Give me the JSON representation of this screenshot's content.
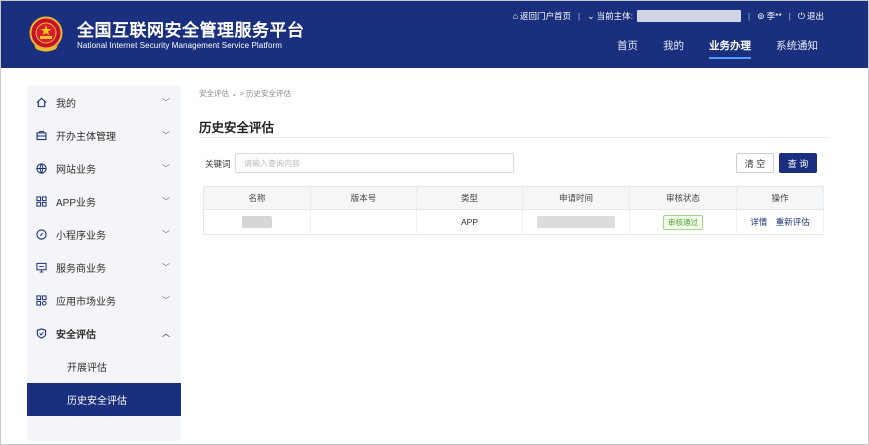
{
  "brand": {
    "title_cn": "全国互联网安全管理服务平台",
    "title_en": "National Internet Security Management Service Platform",
    "emblem_icon": "national-emblem-icon"
  },
  "topbar": {
    "home_link": "返回门户首页",
    "current_entity_label": "当前主体:",
    "user_name": "李**",
    "logout": "退出"
  },
  "nav": {
    "items": [
      {
        "label": "首页",
        "active": false
      },
      {
        "label": "我的",
        "active": false
      },
      {
        "label": "业务办理",
        "active": true
      },
      {
        "label": "系统通知",
        "active": false
      }
    ]
  },
  "sidebar": {
    "items": [
      {
        "label": "我的",
        "icon": "home-icon"
      },
      {
        "label": "开办主体管理",
        "icon": "briefcase-icon"
      },
      {
        "label": "网站业务",
        "icon": "globe-icon"
      },
      {
        "label": "APP业务",
        "icon": "grid-icon"
      },
      {
        "label": "小程序业务",
        "icon": "compass-icon"
      },
      {
        "label": "服务商业务",
        "icon": "monitor-icon"
      },
      {
        "label": "应用市场业务",
        "icon": "apps-icon"
      },
      {
        "label": "安全评估",
        "icon": "shield-icon"
      }
    ],
    "sub_items": [
      {
        "label": "开展评估",
        "active": false
      },
      {
        "label": "历史安全评估",
        "active": true
      }
    ]
  },
  "breadcrumb": {
    "parent": "安全评估",
    "separator": ">",
    "current": "历史安全评估"
  },
  "page_title": "历史安全评估",
  "search": {
    "label": "关键词",
    "placeholder": "请输入查询内容",
    "value": "",
    "clear_label": "清 空",
    "query_label": "查 询"
  },
  "table": {
    "headers": [
      "名称",
      "版本号",
      "类型",
      "申请时间",
      "审核状态",
      "操作"
    ],
    "rows": [
      {
        "name": "",
        "version": "",
        "type": "APP",
        "apply_time": "",
        "status": "审核通过",
        "actions": [
          "详情",
          "重新评估"
        ]
      }
    ]
  },
  "colors": {
    "brand_blue": "#1a2f7e",
    "nav_underline": "#4f9ef8",
    "status_green": "#4ea62c"
  }
}
